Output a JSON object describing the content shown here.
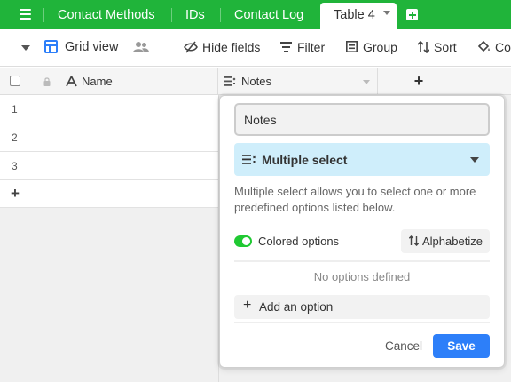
{
  "tabs": {
    "items": [
      {
        "label": "Contact Methods"
      },
      {
        "label": "IDs"
      },
      {
        "label": "Contact Log"
      }
    ],
    "active": {
      "label": "Table 4"
    }
  },
  "toolbar": {
    "view_name": "Grid view",
    "hide_fields": "Hide fields",
    "filter": "Filter",
    "group": "Group",
    "sort": "Sort",
    "color": "Color"
  },
  "grid": {
    "columns": [
      {
        "label": "Name"
      },
      {
        "label": "Notes"
      }
    ],
    "rows": [
      {
        "number": "1"
      },
      {
        "number": "2"
      },
      {
        "number": "3"
      }
    ],
    "add_row": "+",
    "add_column": "+"
  },
  "field_editor": {
    "field_name": "Notes",
    "field_type": "Multiple select",
    "description": "Multiple select allows you to select one or more predefined options listed below.",
    "colored_options_label": "Colored options",
    "colored_options_on": true,
    "alphabetize": "Alphabetize",
    "no_options": "No options defined",
    "add_option": "Add an option",
    "cancel": "Cancel",
    "save": "Save"
  },
  "colors": {
    "tabbar_bg": "#20b43a",
    "accent_blue": "#2d7ff9",
    "type_select_bg": "#cfeefb",
    "toggle_on": "#20c933"
  }
}
